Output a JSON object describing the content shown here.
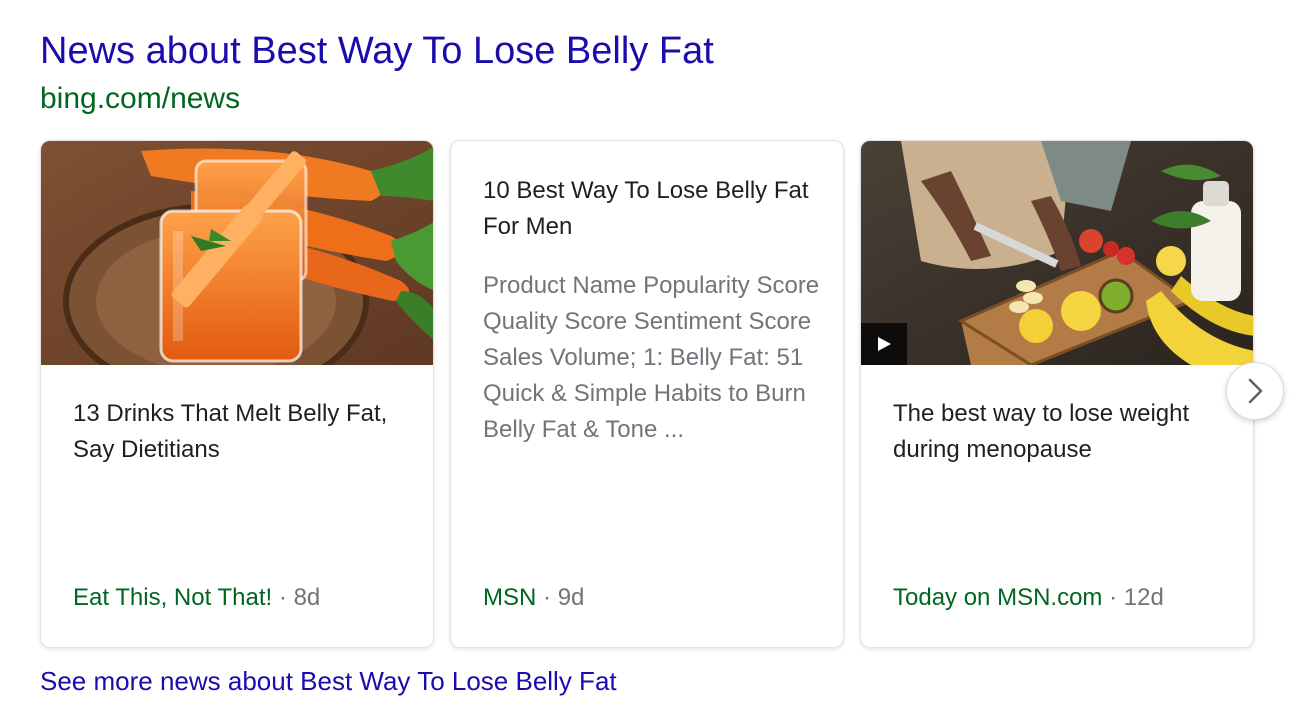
{
  "header": {
    "title": "News about Best Way To Lose Belly Fat",
    "source_url": "bing.com/news"
  },
  "cards": [
    {
      "title": "13 Drinks That Melt Belly Fat, Say Dietitians",
      "source": "Eat This, Not That!",
      "separator": "·",
      "age": "8d",
      "image": "carrot-juice-glasses",
      "has_video": false
    },
    {
      "title": "10 Best Way To Lose Belly Fat For Men",
      "snippet": "Product Name Popularity Score Quality Score Sentiment Score Sales Volume; 1: Belly Fat: 51 Quick & Simple Habits to Burn Belly Fat & Tone ...",
      "source": "MSN",
      "separator": "·",
      "age": "9d",
      "has_video": false
    },
    {
      "title": "The best way to lose weight during menopause",
      "source": "Today on MSN.com",
      "separator": "·",
      "age": "12d",
      "image": "cutting-fruit-on-board",
      "has_video": true
    }
  ],
  "navigation": {
    "next_icon": "chevron-right-icon"
  },
  "footer": {
    "see_more": "See more news about Best Way To Lose Belly Fat"
  },
  "colors": {
    "link": "#1a0dab",
    "url_green": "#006621",
    "meta_gray": "#70757a"
  }
}
